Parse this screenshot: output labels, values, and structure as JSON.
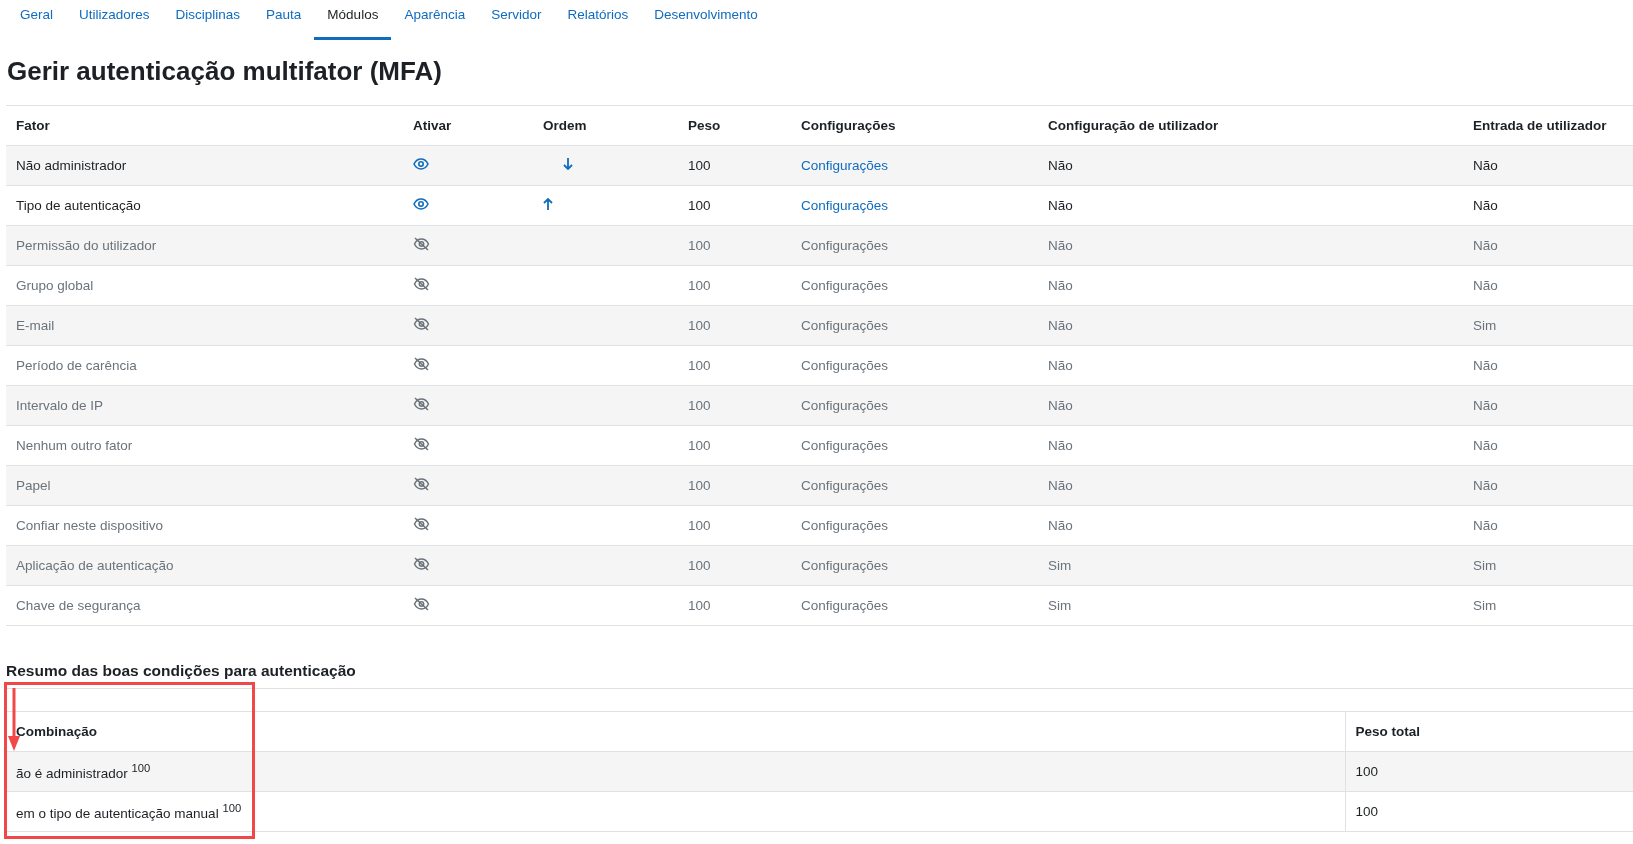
{
  "tabs": [
    {
      "label": "Geral",
      "selected": false
    },
    {
      "label": "Utilizadores",
      "selected": false
    },
    {
      "label": "Disciplinas",
      "selected": false
    },
    {
      "label": "Pauta",
      "selected": false
    },
    {
      "label": "Módulos",
      "selected": true
    },
    {
      "label": "Aparência",
      "selected": false
    },
    {
      "label": "Servidor",
      "selected": false
    },
    {
      "label": "Relatórios",
      "selected": false
    },
    {
      "label": "Desenvolvimento",
      "selected": false
    }
  ],
  "title": "Gerir autenticação multifator (MFA)",
  "factors_table": {
    "columns": [
      "Fator",
      "Ativar",
      "Ordem",
      "Peso",
      "Configurações",
      "Configuração de utilizador",
      "Entrada de utilizador"
    ],
    "rows": [
      {
        "factor": "Não administrador",
        "enabled": true,
        "move_up": false,
        "move_down": true,
        "weight": "100",
        "settings": "Configurações",
        "user_setup": "Não",
        "user_input": "Não"
      },
      {
        "factor": "Tipo de autenticação",
        "enabled": true,
        "move_up": true,
        "move_down": false,
        "weight": "100",
        "settings": "Configurações",
        "user_setup": "Não",
        "user_input": "Não"
      },
      {
        "factor": "Permissão do utilizador",
        "enabled": false,
        "weight": "100",
        "settings": "Configurações",
        "user_setup": "Não",
        "user_input": "Não"
      },
      {
        "factor": "Grupo global",
        "enabled": false,
        "weight": "100",
        "settings": "Configurações",
        "user_setup": "Não",
        "user_input": "Não"
      },
      {
        "factor": "E-mail",
        "enabled": false,
        "weight": "100",
        "settings": "Configurações",
        "user_setup": "Não",
        "user_input": "Sim"
      },
      {
        "factor": "Período de carência",
        "enabled": false,
        "weight": "100",
        "settings": "Configurações",
        "user_setup": "Não",
        "user_input": "Não"
      },
      {
        "factor": "Intervalo de IP",
        "enabled": false,
        "weight": "100",
        "settings": "Configurações",
        "user_setup": "Não",
        "user_input": "Não"
      },
      {
        "factor": "Nenhum outro fator",
        "enabled": false,
        "weight": "100",
        "settings": "Configurações",
        "user_setup": "Não",
        "user_input": "Não"
      },
      {
        "factor": "Papel",
        "enabled": false,
        "weight": "100",
        "settings": "Configurações",
        "user_setup": "Não",
        "user_input": "Não"
      },
      {
        "factor": "Confiar neste dispositivo",
        "enabled": false,
        "weight": "100",
        "settings": "Configurações",
        "user_setup": "Não",
        "user_input": "Não"
      },
      {
        "factor": "Aplicação de autenticação",
        "enabled": false,
        "weight": "100",
        "settings": "Configurações",
        "user_setup": "Sim",
        "user_input": "Sim"
      },
      {
        "factor": "Chave de segurança",
        "enabled": false,
        "weight": "100",
        "settings": "Configurações",
        "user_setup": "Sim",
        "user_input": "Sim"
      }
    ]
  },
  "summary": {
    "heading": "Resumo das boas condições para autenticação",
    "columns": [
      "Combinação",
      "Peso total"
    ],
    "rows": [
      {
        "combination": "ão é administrador $^{100}$",
        "total": "100"
      },
      {
        "combination": "em o tipo de autenticação manual $^{100}$",
        "total": "100"
      }
    ]
  },
  "annotation": {
    "kind": "box-with-arrow"
  }
}
